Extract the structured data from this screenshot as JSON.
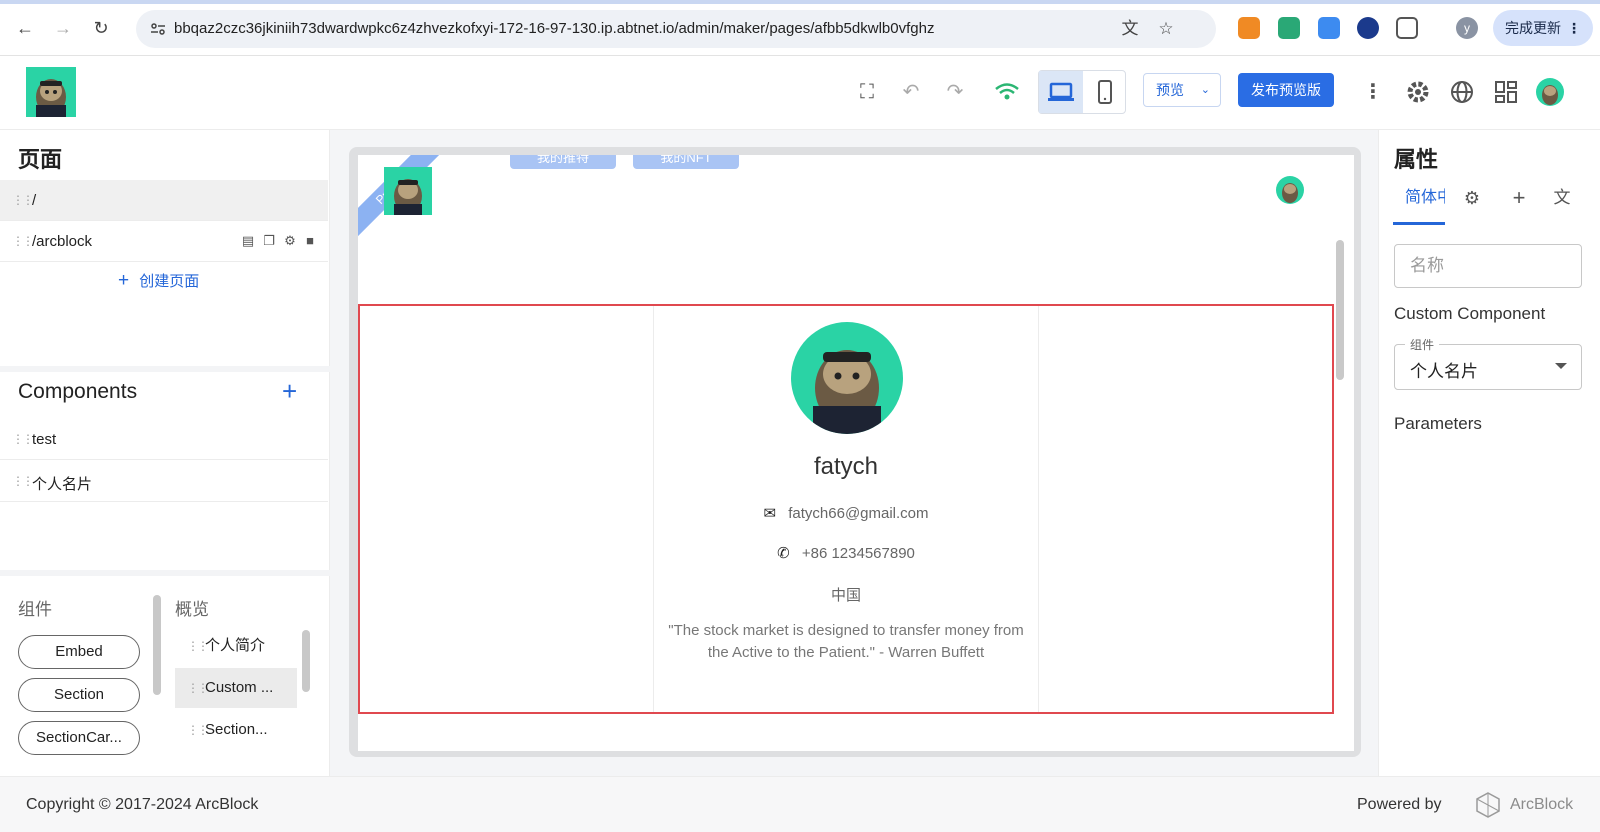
{
  "browser": {
    "url": "bbqaz2czc36jkiniih73dwardwpkc6z4zhvezkofxyi-172-16-97-130.ip.abtnet.io/admin/maker/pages/afbb5dkwlb0vfghz",
    "profile_letter": "y",
    "update_button": "完成更新"
  },
  "toolbar": {
    "preview_label": "预览",
    "publish_label": "发布预览版"
  },
  "pages_panel": {
    "title": "页面",
    "pages": [
      {
        "path": "/"
      },
      {
        "path": "/arcblock"
      }
    ],
    "create_label": "创建页面"
  },
  "components_panel": {
    "title": "Components",
    "items": [
      {
        "label": "test"
      },
      {
        "label": "个人名片"
      }
    ]
  },
  "library": {
    "components_label": "组件",
    "overview_label": "概览",
    "pills": [
      "Embed",
      "Section",
      "SectionCar..."
    ],
    "overview_items": [
      "个人简介",
      "Custom ...",
      "Section..."
    ]
  },
  "canvas": {
    "ribbon": "Preview",
    "top_tabs": [
      "我的推特",
      "我的NFT"
    ],
    "card": {
      "name": "fatych",
      "email": "fatych66@gmail.com",
      "phone": "+86 1234567890",
      "location": "中国",
      "quote": "\"The stock market is designed to transfer money from the Active to the Patient.\" - Warren Buffett"
    }
  },
  "properties_panel": {
    "title": "属性",
    "tab_active": "简体中",
    "name_placeholder": "名称",
    "component_type": "Custom Component",
    "select_legend": "组件",
    "select_value": "个人名片",
    "parameters_label": "Parameters"
  },
  "footer": {
    "copyright": "Copyright © 2017-2024  ArcBlock",
    "powered_by": "Powered by",
    "brand": "ArcBlock"
  },
  "colors": {
    "accent": "#2a6de4",
    "avatar_bg": "#2ad3a5",
    "selection": "#e0484f"
  }
}
